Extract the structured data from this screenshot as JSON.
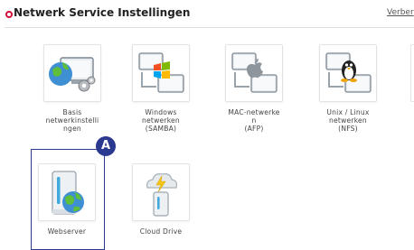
{
  "header": {
    "title": "Netwerk Service Instellingen",
    "link": "Verber",
    "accent_color": "#d0103a"
  },
  "tiles": [
    {
      "label": "Basis\nnetwerkinstelli\nngen",
      "icon": "network-settings-icon"
    },
    {
      "label": "Windows\nnetwerken\n(SAMBA)",
      "icon": "windows-network-icon"
    },
    {
      "label": "MAC-netwerke\nn\n(AFP)",
      "icon": "mac-network-icon"
    },
    {
      "label": "Unix / Linux\nnetwerken\n(NFS)",
      "icon": "linux-network-icon"
    },
    {
      "label": "Webserver",
      "icon": "webserver-icon"
    },
    {
      "label": "Cloud Drive",
      "icon": "cloud-drive-icon"
    }
  ],
  "annotation": {
    "marker": "A",
    "color": "#2b3990"
  }
}
